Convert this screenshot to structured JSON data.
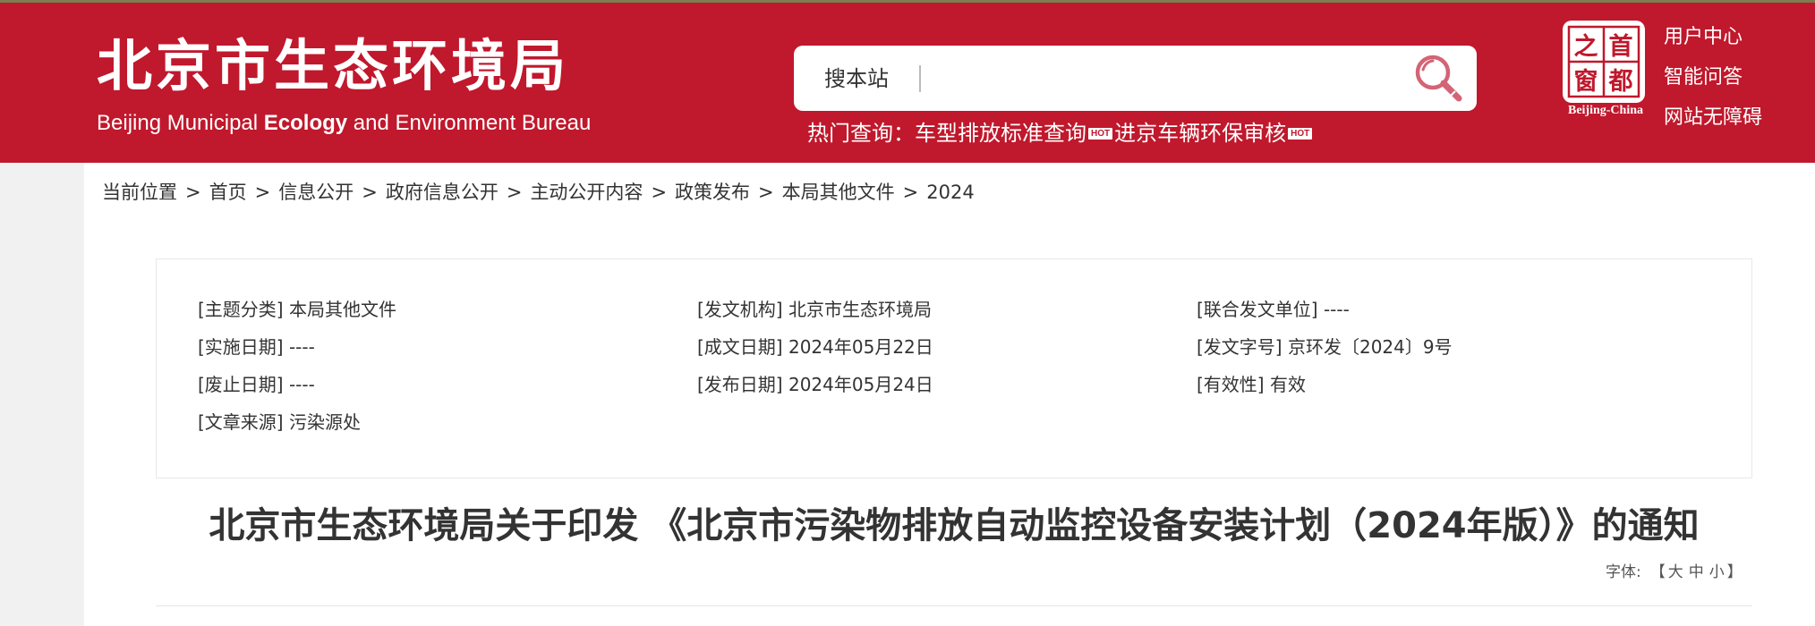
{
  "header": {
    "title_cn": "北京市生态环境局",
    "title_en_part1": "Beijing Municipal",
    "title_en_part2": "Ecology",
    "title_en_part3": "and Environment Bureau",
    "search": {
      "label": "搜本站",
      "placeholder": "",
      "button_icon": "search-icon"
    },
    "hot": {
      "label": "热门查询：",
      "items": [
        {
          "text": "车型排放标准查询",
          "badge": "HOT"
        },
        {
          "text": "进京车辆环保审核",
          "badge": "HOT"
        }
      ]
    },
    "logo": {
      "chars": [
        "首",
        "都",
        "之",
        "窗"
      ],
      "caption": "Beijing-China"
    },
    "links": [
      "用户中心",
      "智能问答",
      "网站无障碍"
    ]
  },
  "breadcrumb": [
    "当前位置",
    "首页",
    "信息公开",
    "政府信息公开",
    "主动公开内容",
    "政策发布",
    "本局其他文件",
    "2024"
  ],
  "meta": [
    {
      "label": "[主题分类]",
      "value": "本局其他文件"
    },
    {
      "label": "[发文机构]",
      "value": "北京市生态环境局"
    },
    {
      "label": "[联合发文单位]",
      "value": "----"
    },
    {
      "label": "[实施日期]",
      "value": "----"
    },
    {
      "label": "[成文日期]",
      "value": "2024年05月22日"
    },
    {
      "label": "[发文字号]",
      "value": "京环发〔2024〕9号"
    },
    {
      "label": "[废止日期]",
      "value": "----"
    },
    {
      "label": "[发布日期]",
      "value": "2024年05月24日"
    },
    {
      "label": "[有效性]",
      "value": "有效"
    },
    {
      "label": "[文章来源]",
      "value": "污染源处"
    }
  ],
  "article": {
    "title": "北京市生态环境局关于印发 《北京市污染物排放自动监控设备安装计划（2024年版）》的通知",
    "font_label": "字体:",
    "font_open": "【",
    "font_sizes": [
      "大",
      "中",
      "小"
    ],
    "font_close": "】"
  },
  "colors": {
    "brand_red": "#c0182c",
    "header_text": "#ffffff",
    "body_text": "#333333"
  }
}
